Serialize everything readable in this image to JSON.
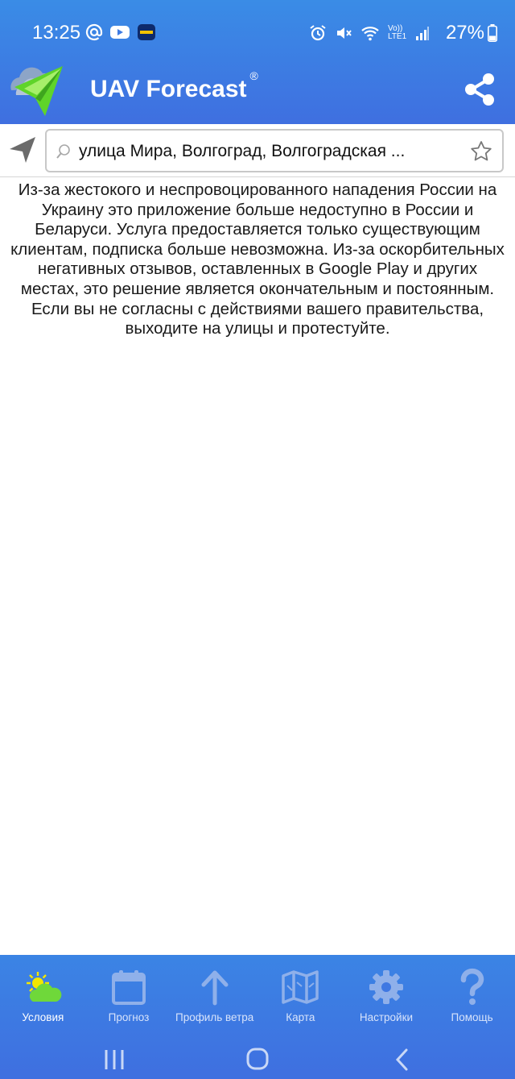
{
  "status_bar": {
    "time": "13:25",
    "battery": "27%",
    "network_label": "Vo)) LTE1",
    "icons": [
      "at-icon",
      "youtube-icon",
      "metro-icon",
      "alarm-icon",
      "mute-icon",
      "wifi-icon",
      "signal-icon",
      "battery-icon"
    ]
  },
  "app_bar": {
    "title": "UAV Forecast",
    "registered_mark": "®",
    "colors": {
      "bar": "#3f7ce3",
      "logo_green": "#5fd42a"
    }
  },
  "search": {
    "value": "улица Мира, Волгоград, Волгоградская ..."
  },
  "notice": "Из-за жестокого и неспровоцированного нападения России на Украину это приложение больше недоступно в России и Беларуси. Услуга предоставляется только существующим клиентам, подписка больше невозможна. Из-за оскорбительных негативных отзывов, оставленных в Google Play и других местах, это решение является окончательным и постоянным. Если вы не согласны с действиями вашего правительства, выходите на улицы и протестуйте.",
  "bottom_nav": {
    "items": [
      {
        "label": "Условия",
        "icon": "weather-icon",
        "active": true
      },
      {
        "label": "Прогноз",
        "icon": "calendar-icon",
        "active": false
      },
      {
        "label": "Профиль ветра",
        "icon": "arrow-up-icon",
        "active": false
      },
      {
        "label": "Карта",
        "icon": "map-icon",
        "active": false
      },
      {
        "label": "Настройки",
        "icon": "gear-icon",
        "active": false
      },
      {
        "label": "Помощь",
        "icon": "question-icon",
        "active": false
      }
    ]
  }
}
